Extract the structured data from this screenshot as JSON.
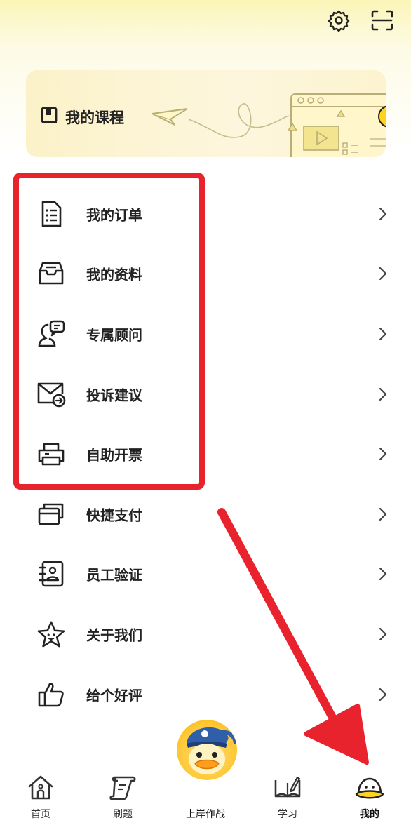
{
  "course_card": {
    "title": "我的课程"
  },
  "menu": [
    {
      "label": "我的订单",
      "icon": "document-list-icon"
    },
    {
      "label": "我的资料",
      "icon": "inbox-tray-icon"
    },
    {
      "label": "专属顾问",
      "icon": "consultant-chat-icon"
    },
    {
      "label": "投诉建议",
      "icon": "feedback-mail-icon"
    },
    {
      "label": "自助开票",
      "icon": "printer-icon"
    },
    {
      "label": "快捷支付",
      "icon": "card-stack-icon"
    },
    {
      "label": "员工验证",
      "icon": "employee-id-icon"
    },
    {
      "label": "关于我们",
      "icon": "star-icon"
    },
    {
      "label": "给个好评",
      "icon": "thumbs-up-icon"
    }
  ],
  "tabs": [
    {
      "label": "首页",
      "icon": "home-icon"
    },
    {
      "label": "刷题",
      "icon": "scroll-quiz-icon"
    },
    {
      "label": "上岸作战",
      "icon": "duck-mascot-icon"
    },
    {
      "label": "学习",
      "icon": "open-book-pen-icon"
    },
    {
      "label": "我的",
      "icon": "duck-profile-icon"
    }
  ],
  "colors": {
    "accent_yellow": "#ffd43b",
    "annotation_red": "#e8232d",
    "text": "#222222"
  }
}
